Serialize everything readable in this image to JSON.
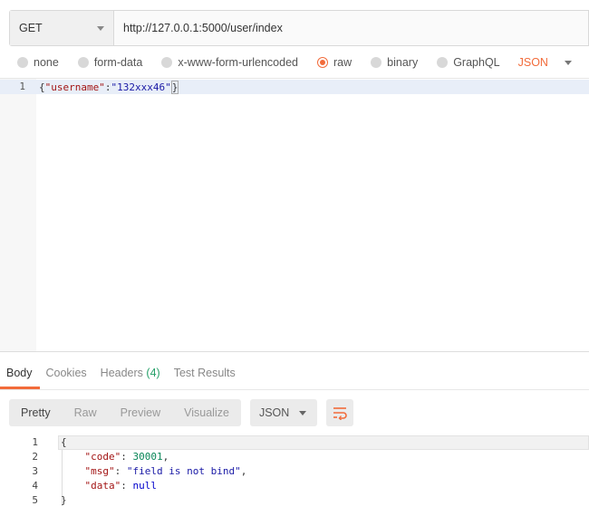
{
  "request": {
    "method": "GET",
    "url": "http://127.0.0.1:5000/user/index"
  },
  "body_types": [
    {
      "label": "none",
      "selected": false
    },
    {
      "label": "form-data",
      "selected": false
    },
    {
      "label": "x-www-form-urlencoded",
      "selected": false
    },
    {
      "label": "raw",
      "selected": true
    },
    {
      "label": "binary",
      "selected": false
    },
    {
      "label": "GraphQL",
      "selected": false
    }
  ],
  "raw_language": "JSON",
  "editor": {
    "line_number": "1",
    "open": "{",
    "key": "\"username\"",
    "colon": ":",
    "value": "\"132xxx46\"",
    "close": "}"
  },
  "response_tabs": {
    "body": "Body",
    "cookies": "Cookies",
    "headers": "Headers",
    "headers_count": "(4)",
    "test_results": "Test Results"
  },
  "view_modes": [
    "Pretty",
    "Raw",
    "Preview",
    "Visualize"
  ],
  "response_format": "JSON",
  "response_body": {
    "line_numbers": [
      "1",
      "2",
      "3",
      "4",
      "5"
    ],
    "open": "{",
    "code_key": "\"code\"",
    "code_value": "30001",
    "msg_key": "\"msg\"",
    "msg_value": "\"field is not bind\"",
    "data_key": "\"data\"",
    "data_value": "null",
    "close": "}"
  },
  "colors": {
    "accent": "#f26b3a",
    "count_green": "#26a069"
  }
}
